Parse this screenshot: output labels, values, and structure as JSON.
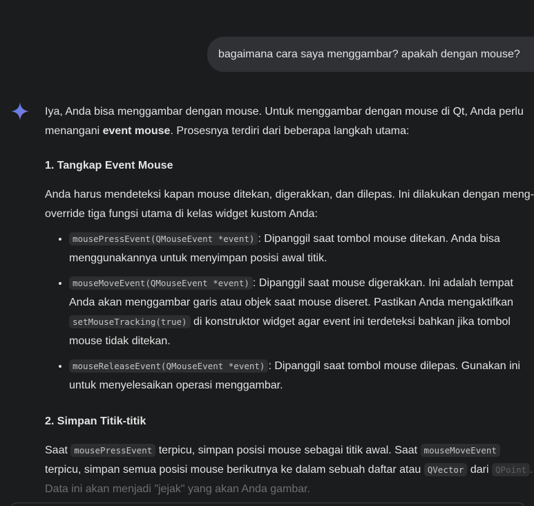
{
  "user_message": "bagaimana cara saya menggambar? apakah dengan mouse?",
  "assistant": {
    "icon": "gemini-spark-icon",
    "intro_1": "Iya, Anda bisa menggambar dengan mouse. Untuk menggambar dengan mouse di Qt, Anda perlu menangani ",
    "intro_bold": "event mouse",
    "intro_2": ". Prosesnya terdiri dari beberapa langkah utama:",
    "section1": {
      "heading": "1. Tangkap Event Mouse",
      "paragraph": "Anda harus mendeteksi kapan mouse ditekan, digerakkan, dan dilepas. Ini dilakukan dengan meng-override tiga fungsi utama di kelas widget kustom Anda:",
      "bullets": [
        {
          "code": "mousePressEvent(QMouseEvent *event)",
          "text": ": Dipanggil saat tombol mouse ditekan. Anda bisa menggunakannya untuk menyimpan posisi awal titik."
        },
        {
          "code": "mouseMoveEvent(QMouseEvent *event)",
          "text": ": Dipanggil saat mouse digerakkan. Ini adalah tempat Anda akan menggambar garis atau objek saat mouse diseret. Pastikan Anda mengaktifkan ",
          "code2": "setMouseTracking(true)",
          "text2": " di konstruktor widget agar event ini terdeteksi bahkan jika tombol mouse tidak ditekan."
        },
        {
          "code": "mouseReleaseEvent(QMouseEvent *event)",
          "text": ": Dipanggil saat tombol mouse dilepas. Gunakan ini untuk menyelesaikan operasi menggambar."
        }
      ]
    },
    "section2": {
      "heading": "2. Simpan Titik-titik",
      "t1": "Saat ",
      "c1": "mousePressEvent",
      "t2": " terpicu, simpan posisi mouse sebagai titik awal. Saat ",
      "c2": "mouseMoveEvent",
      "t3": " terpicu, simpan semua posisi mouse berikutnya ke dalam sebuah daftar atau ",
      "c3": "QVector",
      "t4": " dari ",
      "c4": "QPoint",
      "t5": ". Data ini akan menjadi \"jejak\" yang akan Anda gambar."
    }
  },
  "colors": {
    "background": "#1b1c1d",
    "bubble": "#303134",
    "text": "#e3e3e3",
    "code_bg": "#2d2e30",
    "spark_gradient": [
      "#4285f4",
      "#9b72cb"
    ]
  }
}
